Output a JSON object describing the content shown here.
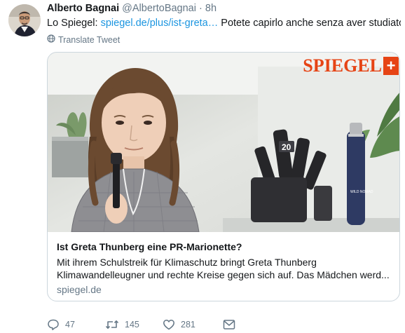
{
  "tweet": {
    "author_name": "Alberto Bagnai",
    "author_handle": "@AlbertoBagnai",
    "separator": "·",
    "time": "8h",
    "text_prefix": "Lo Spiegel: ",
    "text_link": "spiegel.de/plus/ist-greta…",
    "text_suffix": " Potete capirlo anche senza aver studiato...",
    "translate_label": "Translate Tweet"
  },
  "card": {
    "brand_word": "SPIEGEL",
    "brand_plus": "+",
    "title": "Ist Greta Thunberg eine PR-Marionette?",
    "description_line1": "Mit ihrem Schulstreik für Klimaschutz bringt Greta Thunberg",
    "description_line2": "Klimawandelleugner und rechte Kreise gegen sich auf. Das Mädchen werd...",
    "domain": "spiegel.de",
    "microphone_label": "20",
    "bottle_label": "WILD NOMAD"
  },
  "actions": {
    "replies": "47",
    "retweets": "145",
    "likes": "281"
  },
  "colors": {
    "link": "#1b95e0",
    "secondary_text": "#657786",
    "spiegel_orange": "#e64415",
    "border": "#ccd6dd"
  },
  "icons": {
    "globe": "globe-icon",
    "reply": "reply-icon",
    "retweet": "retweet-icon",
    "like": "heart-icon",
    "dm": "envelope-icon"
  }
}
